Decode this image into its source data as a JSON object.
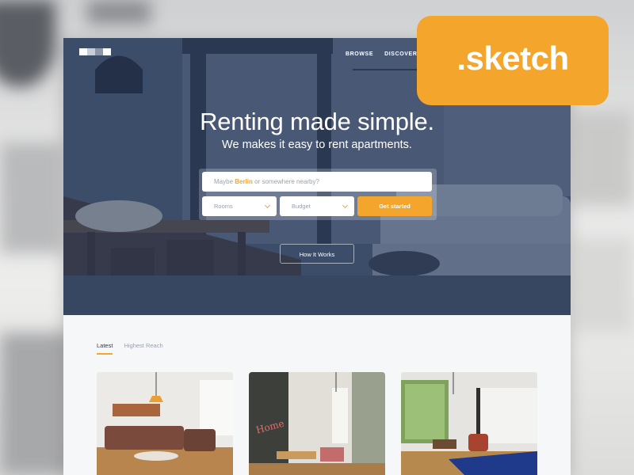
{
  "nav": {
    "items": [
      "BROWSE",
      "DISCOVER"
    ]
  },
  "hero": {
    "title": "Renting made simple.",
    "subtitle": "We makes it easy to rent apartments."
  },
  "search": {
    "placeholder_prefix": "Maybe ",
    "placeholder_highlight": "Berlin",
    "placeholder_suffix": " or somewhere nearby?",
    "rooms_label": "Rooms",
    "budget_label": "Budget",
    "cta_label": "Get started"
  },
  "how_it_works_label": "How It Works",
  "tabs": [
    {
      "label": "Latest",
      "active": true
    },
    {
      "label": "Highest Reach",
      "active": false
    }
  ],
  "badge": {
    "label": ".sketch"
  },
  "colors": {
    "accent": "#f4a52c",
    "hero_overlay": "#283a5c",
    "page_bg": "#f6f7f9"
  },
  "icons": [
    "logo-mark",
    "chevron-down-icon"
  ]
}
